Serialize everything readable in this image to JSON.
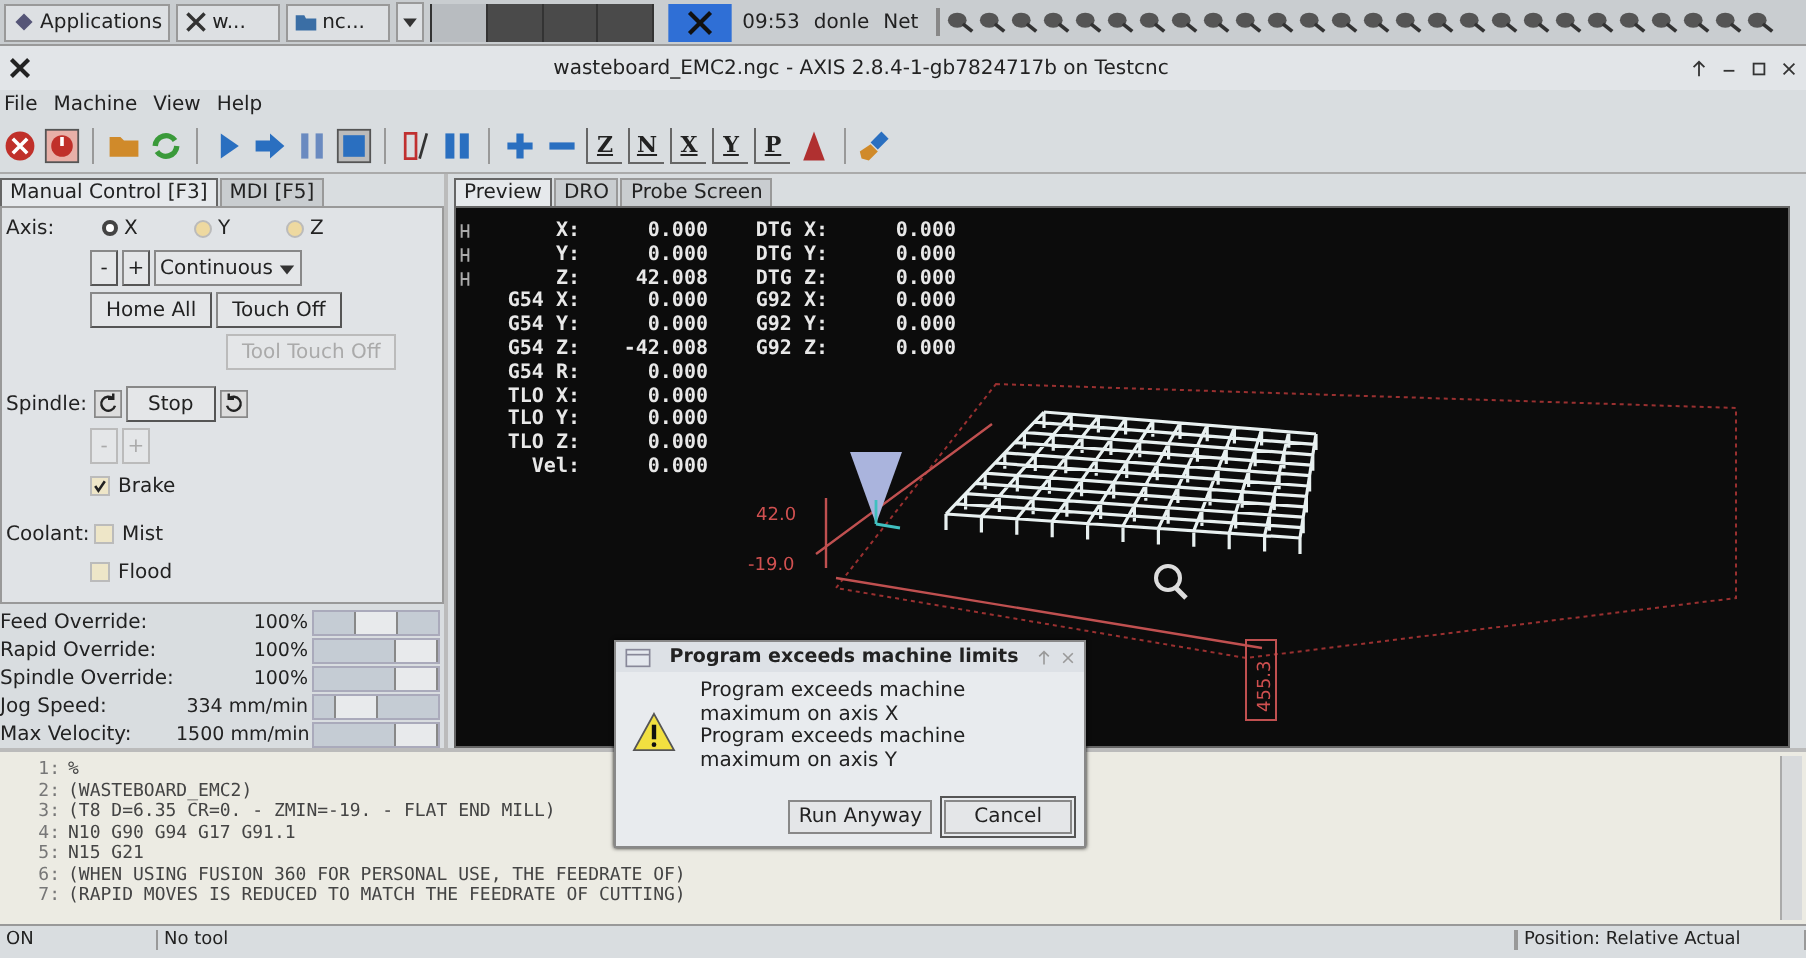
{
  "taskbar": {
    "apps_label": "Applications",
    "windows": [
      {
        "kind": "x",
        "label": "w..."
      },
      {
        "kind": "folder",
        "label": "nc..."
      }
    ],
    "clock": "09:53",
    "user": "donle",
    "network": "Net"
  },
  "window": {
    "title": "wasteboard_EMC2.ngc - AXIS 2.8.4-1-gb7824717b on Testcnc"
  },
  "menu": [
    "File",
    "Machine",
    "View",
    "Help"
  ],
  "toolbar": [
    {
      "kind": "estop"
    },
    {
      "kind": "power"
    },
    {
      "kind": "sep"
    },
    {
      "kind": "open"
    },
    {
      "kind": "reload"
    },
    {
      "kind": "sep"
    },
    {
      "kind": "run"
    },
    {
      "kind": "step"
    },
    {
      "kind": "pause"
    },
    {
      "kind": "stop"
    },
    {
      "kind": "sep"
    },
    {
      "kind": "blockdel"
    },
    {
      "kind": "optstop"
    },
    {
      "kind": "sep"
    },
    {
      "kind": "zoomin"
    },
    {
      "kind": "zoomout"
    },
    {
      "kind": "view",
      "label": "Z"
    },
    {
      "kind": "view",
      "label": "N"
    },
    {
      "kind": "view",
      "label": "X"
    },
    {
      "kind": "view",
      "label": "Y"
    },
    {
      "kind": "view",
      "label": "P"
    },
    {
      "kind": "rotate"
    },
    {
      "kind": "sep"
    },
    {
      "kind": "clear"
    }
  ],
  "left_tabs": [
    {
      "label": "Manual Control [F3]",
      "selected": true
    },
    {
      "label": "MDI [F5]",
      "selected": false
    }
  ],
  "manual": {
    "axis_label": "Axis:",
    "axes": [
      {
        "label": "X",
        "selected": true
      },
      {
        "label": "Y",
        "selected": false
      },
      {
        "label": "Z",
        "selected": false
      }
    ],
    "jog_minus": "-",
    "jog_plus": "+",
    "jog_mode": "Continuous",
    "home_all": "Home All",
    "touch_off": "Touch Off",
    "tool_touch_off": {
      "label": "Tool Touch Off",
      "disabled": true
    },
    "spindle_label": "Spindle:",
    "spindle_stop": "Stop",
    "spindle_minus": {
      "label": "-",
      "disabled": true
    },
    "spindle_plus": {
      "label": "+",
      "disabled": true
    },
    "brake": {
      "label": "Brake",
      "checked": true
    },
    "coolant_label": "Coolant:",
    "mist": {
      "label": "Mist",
      "checked": false
    },
    "flood": {
      "label": "Flood",
      "checked": false
    }
  },
  "sliders": [
    {
      "label": "Feed Override:",
      "reading": "100%",
      "level": 0.5
    },
    {
      "label": "Rapid Override:",
      "reading": "100%",
      "level": 1
    },
    {
      "label": "Spindle Override:",
      "reading": "100%",
      "level": 1
    },
    {
      "label": "Jog Speed:",
      "reading": "334 mm/min",
      "level": 0.25
    },
    {
      "label": "Max Velocity:",
      "reading": "1500 mm/min",
      "level": 1
    }
  ],
  "preview_tabs": [
    {
      "label": "Preview",
      "selected": true
    },
    {
      "label": "DRO",
      "selected": false
    },
    {
      "label": "Probe Screen",
      "selected": false
    }
  ],
  "dro": [
    {
      "homed": true,
      "label": "X:",
      "value": "0.000",
      "label2": "DTG X:",
      "value2": "0.000"
    },
    {
      "homed": true,
      "label": "Y:",
      "value": "0.000",
      "label2": "DTG Y:",
      "value2": "0.000"
    },
    {
      "homed": true,
      "label": "Z:",
      "value": "42.008",
      "label2": "DTG Z:",
      "value2": "0.000"
    },
    {
      "homed": false,
      "label": "G54 X:",
      "value": "0.000",
      "label2": "G92 X:",
      "value2": "0.000"
    },
    {
      "homed": false,
      "label": "G54 Y:",
      "value": "0.000",
      "label2": "G92 Y:",
      "value2": "0.000"
    },
    {
      "homed": false,
      "label": "G54 Z:",
      "value": "-42.008",
      "label2": "G92 Z:",
      "value2": "0.000"
    },
    {
      "homed": false,
      "label": "G54 R:",
      "value": "0.000"
    },
    {
      "homed": false,
      "label": "TLO X:",
      "value": "0.000"
    },
    {
      "homed": false,
      "label": "TLO Y:",
      "value": "0.000"
    },
    {
      "homed": false,
      "label": "TLO Z:",
      "value": "0.000"
    },
    {
      "homed": false,
      "label": "Vel:",
      "value": "0.000"
    }
  ],
  "preview_dims": {
    "z_max": "42.0",
    "z_min": "-19.0",
    "y_extent": "455.3"
  },
  "gcode": [
    {
      "num": "1:",
      "text": "%"
    },
    {
      "num": "2:",
      "text": "(WASTEBOARD_EMC2)"
    },
    {
      "num": "3:",
      "text": "(T8 D=6.35 CR=0. - ZMIN=-19. - FLAT END MILL)"
    },
    {
      "num": "4:",
      "text": "N10 G90 G94 G17 G91.1"
    },
    {
      "num": "5:",
      "text": "N15 G21"
    },
    {
      "num": "6:",
      "text": "(WHEN USING FUSION 360 FOR PERSONAL USE, THE FEEDRATE OF)"
    },
    {
      "num": "7:",
      "text": "(RAPID MOVES IS REDUCED TO MATCH THE FEEDRATE OF CUTTING)"
    }
  ],
  "status_bar": {
    "machine": "ON",
    "tool": "No tool",
    "position": "Position: Relative Actual"
  },
  "dialog": {
    "title": "Program exceeds machine limits",
    "messages": [
      "Program exceeds machine maximum on axis X",
      "Program exceeds machine maximum on axis Y"
    ],
    "buttons": [
      {
        "label": "Run Anyway",
        "default": false
      },
      {
        "label": "Cancel",
        "default": true
      }
    ]
  }
}
